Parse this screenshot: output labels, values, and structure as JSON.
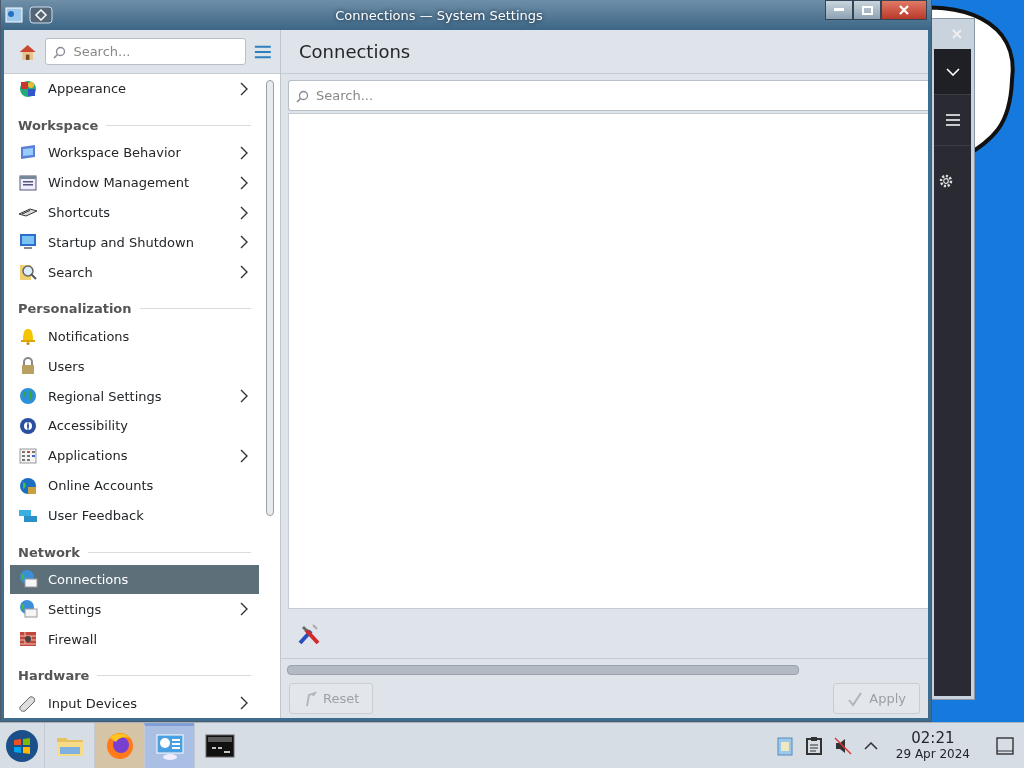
{
  "window": {
    "title": "Connections — System Settings"
  },
  "sidebar": {
    "search": {
      "placeholder": "Search..."
    },
    "items": [
      {
        "kind": "item",
        "label": "Appearance",
        "has_children": true,
        "selected": false
      },
      {
        "kind": "header",
        "label": "Workspace"
      },
      {
        "kind": "item",
        "label": "Workspace Behavior",
        "has_children": true,
        "selected": false
      },
      {
        "kind": "item",
        "label": "Window Management",
        "has_children": true,
        "selected": false
      },
      {
        "kind": "item",
        "label": "Shortcuts",
        "has_children": true,
        "selected": false
      },
      {
        "kind": "item",
        "label": "Startup and Shutdown",
        "has_children": true,
        "selected": false
      },
      {
        "kind": "item",
        "label": "Search",
        "has_children": true,
        "selected": false
      },
      {
        "kind": "header",
        "label": "Personalization"
      },
      {
        "kind": "item",
        "label": "Notifications",
        "has_children": false,
        "selected": false
      },
      {
        "kind": "item",
        "label": "Users",
        "has_children": false,
        "selected": false
      },
      {
        "kind": "item",
        "label": "Regional Settings",
        "has_children": true,
        "selected": false
      },
      {
        "kind": "item",
        "label": "Accessibility",
        "has_children": false,
        "selected": false
      },
      {
        "kind": "item",
        "label": "Applications",
        "has_children": true,
        "selected": false
      },
      {
        "kind": "item",
        "label": "Online Accounts",
        "has_children": false,
        "selected": false
      },
      {
        "kind": "item",
        "label": "User Feedback",
        "has_children": false,
        "selected": false
      },
      {
        "kind": "header",
        "label": "Network"
      },
      {
        "kind": "item",
        "label": "Connections",
        "has_children": false,
        "selected": true
      },
      {
        "kind": "item",
        "label": "Settings",
        "has_children": true,
        "selected": false
      },
      {
        "kind": "item",
        "label": "Firewall",
        "has_children": false,
        "selected": false
      },
      {
        "kind": "header",
        "label": "Hardware"
      },
      {
        "kind": "item",
        "label": "Input Devices",
        "has_children": true,
        "selected": false
      }
    ]
  },
  "page": {
    "title": "Connections",
    "search": {
      "placeholder": "Search..."
    },
    "buttons": [
      {
        "label": "Reset",
        "disabled": true
      },
      {
        "label": "Apply",
        "disabled": true
      }
    ]
  },
  "taskbar": {
    "apps": [
      {
        "selected": false,
        "attention": false
      },
      {
        "selected": false,
        "attention": true
      },
      {
        "selected": true,
        "attention": false
      },
      {
        "selected": false,
        "attention": false
      }
    ],
    "clock": {
      "time": "02:21",
      "date": "29 Apr 2024"
    }
  }
}
